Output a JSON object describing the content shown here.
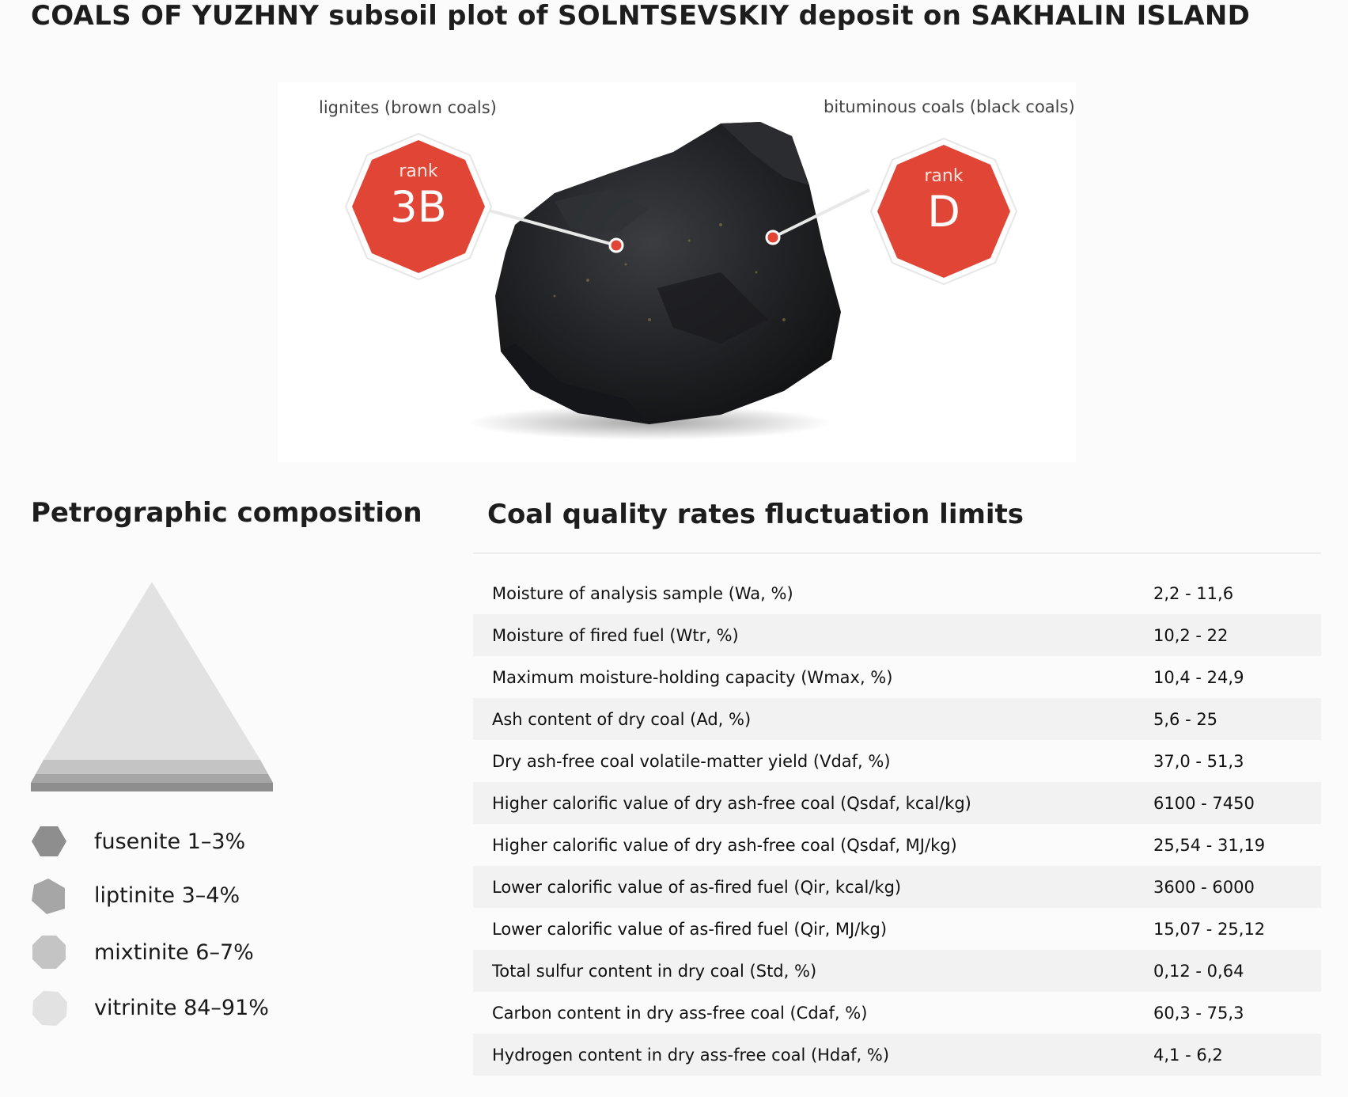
{
  "page": {
    "title": "COALS OF YUZHNY subsoil plot of SOLNTSEVSKIY deposit on SAKHALIN ISLAND"
  },
  "ranks": {
    "left": {
      "category": "lignites (brown coals)",
      "rank_word": "rank",
      "value": "3B",
      "color": "#e04535"
    },
    "right": {
      "category": "bituminous coals (black coals)",
      "rank_word": "rank",
      "value": "D",
      "color": "#e04535"
    }
  },
  "petrography": {
    "title": "Petrographic composition",
    "components": [
      {
        "label": "fusenite 1–3%",
        "color": "#8e8e8e",
        "shape": "hexagon-icon"
      },
      {
        "label": "liptinite 3–4%",
        "color": "#a6a6a6",
        "shape": "pentagon-icon"
      },
      {
        "label": "mixtinite 6–7%",
        "color": "#c4c4c4",
        "shape": "heptagon-icon"
      },
      {
        "label": "vitrinite 84–91%",
        "color": "#e2e2e2",
        "shape": "octagon-icon"
      }
    ]
  },
  "quality": {
    "title": "Coal quality rates fluctuation limits",
    "rows": [
      {
        "parameter": "Moisture of analysis sample (Wa, %)",
        "range": "2,2 - 11,6"
      },
      {
        "parameter": "Moisture of fired fuel (Wtr, %)",
        "range": "10,2 - 22"
      },
      {
        "parameter": "Maximum moisture-holding capacity (Wmax, %)",
        "range": "10,4 - 24,9"
      },
      {
        "parameter": "Ash content of dry coal (Ad, %)",
        "range": "5,6 - 25"
      },
      {
        "parameter": "Dry ash-free coal volatile-matter yield (Vdaf, %)",
        "range": "37,0 - 51,3"
      },
      {
        "parameter": "Higher calorific value of dry ash-free coal (Qsdaf, kcal/kg)",
        "range": "6100 - 7450"
      },
      {
        "parameter": "Higher calorific value of dry ash-free coal (Qsdaf, MJ/kg)",
        "range": "25,54 - 31,19"
      },
      {
        "parameter": "Lower calorific value of as-fired fuel (Qir, kcal/kg)",
        "range": "3600 - 6000"
      },
      {
        "parameter": "Lower calorific value of as-fired fuel (Qir, MJ/kg)",
        "range": "15,07 - 25,12"
      },
      {
        "parameter": "Total sulfur content in dry coal (Std, %)",
        "range": "0,12 - 0,64"
      },
      {
        "parameter": "Carbon content in dry ass-free coal (Cdaf, %)",
        "range": "60,3 - 75,3"
      },
      {
        "parameter": "Hydrogen content in dry ass-free coal (Hdaf, %)",
        "range": "4,1 - 6,2"
      }
    ]
  }
}
